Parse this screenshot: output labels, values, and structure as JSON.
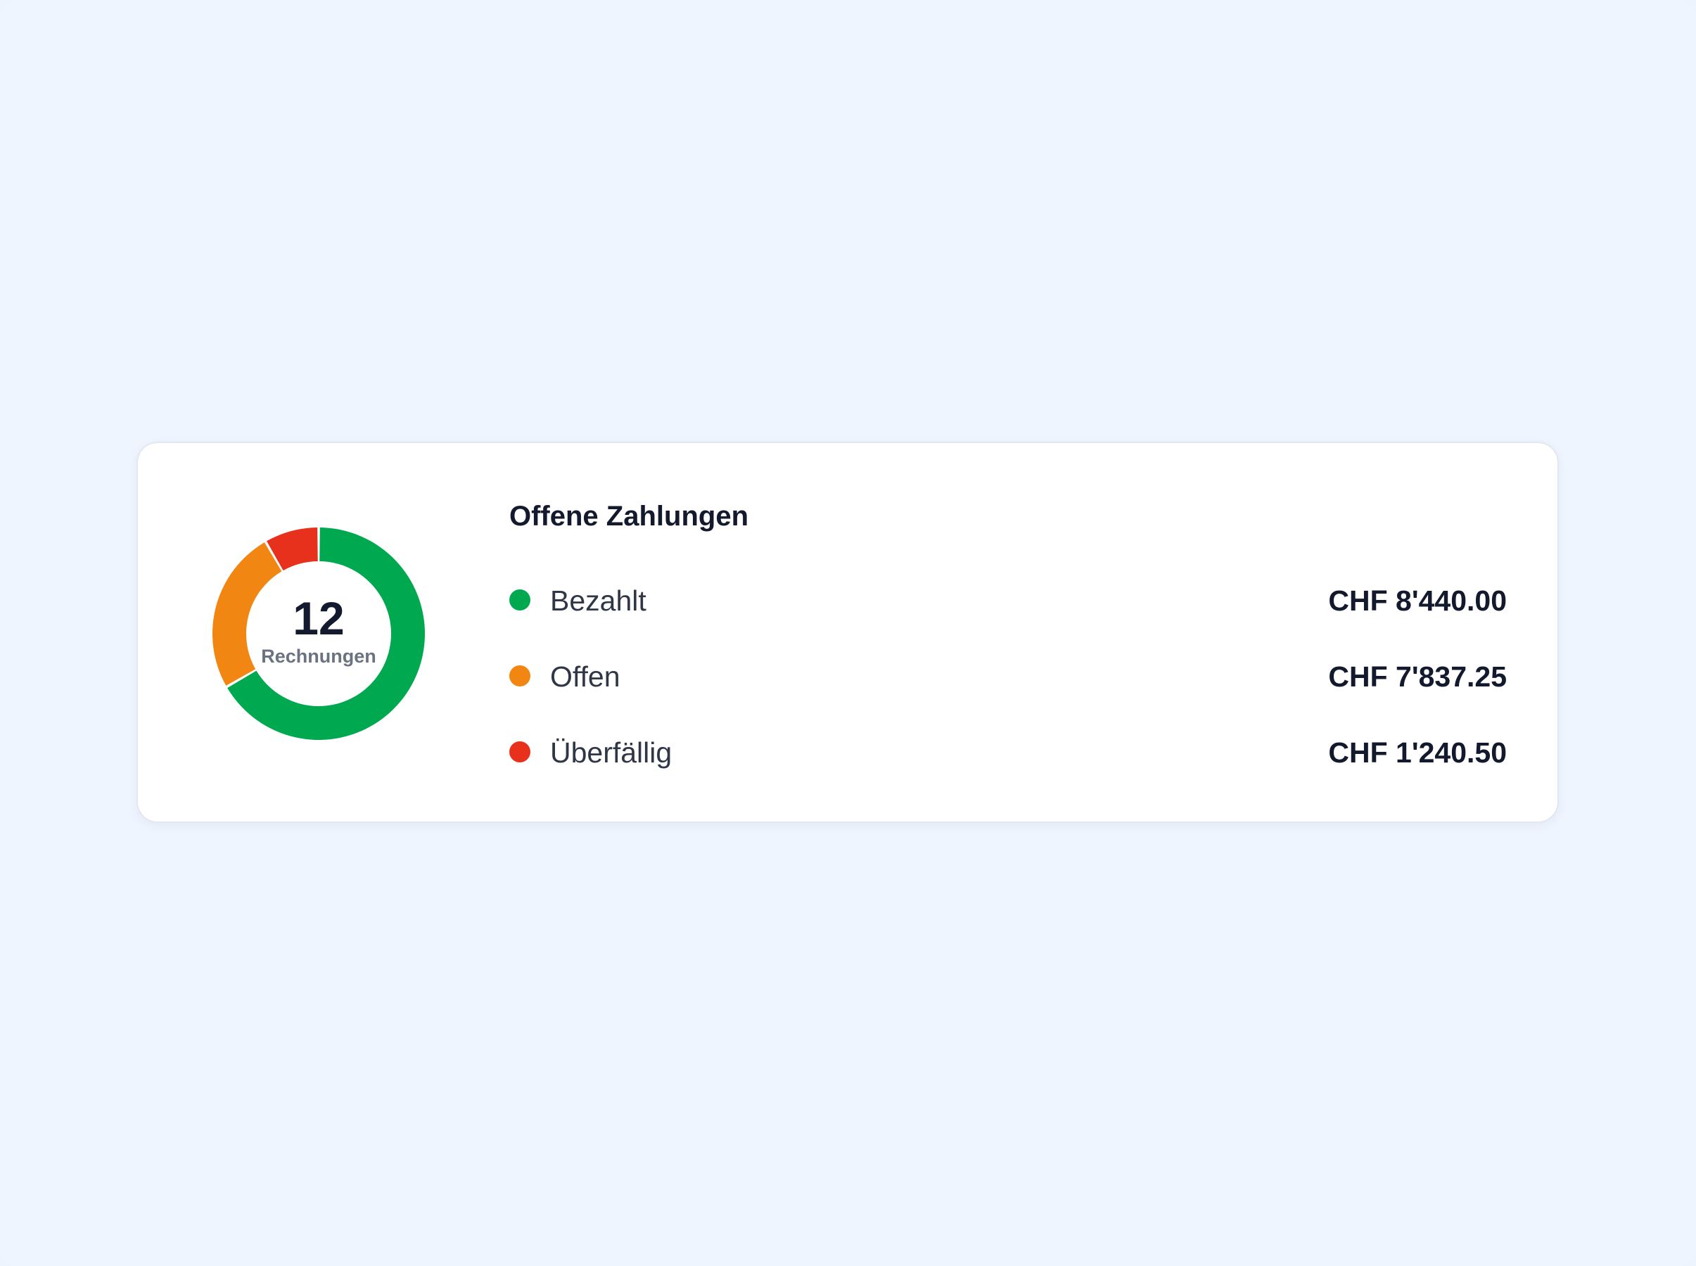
{
  "card": {
    "title": "Offene Zahlungen",
    "donut": {
      "count": "12",
      "caption": "Rechnungen"
    },
    "legend": [
      {
        "label": "Bezahlt",
        "value": "CHF 8'440.00",
        "color": "#00a94f"
      },
      {
        "label": "Offen",
        "value": "CHF 7'837.25",
        "color": "#f28612"
      },
      {
        "label": "Überfällig",
        "value": "CHF 1'240.50",
        "color": "#e8311c"
      }
    ]
  },
  "chart_data": {
    "type": "pie",
    "style": "donut",
    "categories": [
      "Bezahlt",
      "Offen",
      "Überfällig"
    ],
    "values": [
      8,
      3,
      1
    ],
    "colors": [
      "#00a94f",
      "#f28612",
      "#e8311c"
    ]
  }
}
